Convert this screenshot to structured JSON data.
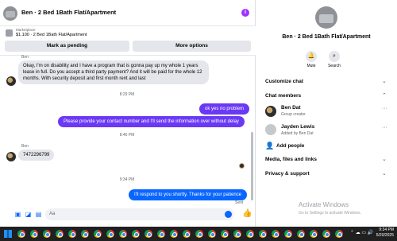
{
  "header": {
    "title": "Ben · 2 Bed 1Bath Flat/Apartment",
    "chevron": "⌄",
    "info_icon": "info-icon"
  },
  "marketplace": {
    "label": "Marketplace",
    "item": "$1,100 · 2 Bed 1Bath Flat/Apartment",
    "btn_pending": "Mark as pending",
    "btn_more": "More options"
  },
  "messages": {
    "sender1": "Ben",
    "msg1": "Okay, I'm on disability and I have a program that is gonna pay up my whole 1 years lease in full. Do you accept a third party payment? And it will be paid for the whole 12 months.  With security deposit and first month rent and last",
    "ts1": "8:29 PM",
    "out1": "ok yes no problem",
    "out2": "Please provide your contact number and I'll send the information over without delay",
    "ts2": "8:46 PM",
    "sender2": "Ben",
    "msg2": "7472296799",
    "ts3": "9:34 PM",
    "out3": "I'll respond to you shortly. Thanks for your patience",
    "sent": "Sent"
  },
  "composer": {
    "placeholder": "Aa"
  },
  "info": {
    "title": "Ben · 2 Bed 1Bath Flat/Apartment",
    "mute": "Mute",
    "search": "Search",
    "customize": "Customize chat",
    "members": "Chat members",
    "member1_name": "Ben Dat",
    "member1_role": "Group creator",
    "member2_name": "Jayden Lewis",
    "member2_role": "Added by Ben Dat",
    "add_people": "Add people",
    "media": "Media, files and links",
    "privacy": "Privacy & support"
  },
  "watermark": {
    "title": "Activate Windows",
    "sub": "Go to Settings to activate Windows."
  },
  "taskbar": {
    "time": "9:34 PM",
    "date": "5/20/2025"
  },
  "colors": {
    "accent": "#0866ff",
    "outgoing": "#6b38f5",
    "info": "#a033ff"
  }
}
